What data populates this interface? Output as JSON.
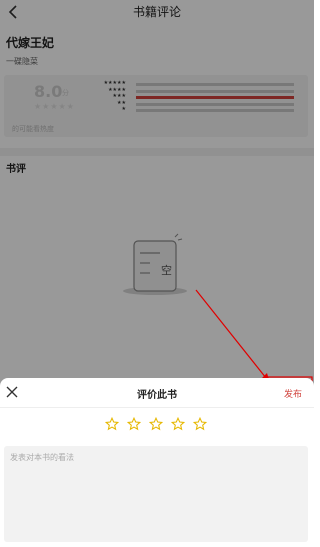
{
  "header": {
    "title": "书籍评论",
    "back_icon": "chevron-left-icon"
  },
  "book": {
    "name": "代嫁王妃",
    "author": "一碟隐菜"
  },
  "rating": {
    "score": "8.0",
    "score_unit": "分",
    "stars": "★★★★★",
    "note": "的可能看热度",
    "distribution": [
      {
        "stars": "★★★★★",
        "fraction": 0.0
      },
      {
        "stars": "★★★★",
        "fraction": 0.0
      },
      {
        "stars": "★★★",
        "fraction": 1.0
      },
      {
        "stars": "★★",
        "fraction": 0.0
      },
      {
        "stars": "★",
        "fraction": 0.0
      }
    ],
    "accent_color": "#d0423c"
  },
  "reviews": {
    "section_title": "书评",
    "empty_label": "空"
  },
  "sheet": {
    "close_icon": "close-icon",
    "title": "评价此书",
    "publish_label": "发布",
    "star_count": 5,
    "star_color": "#e6b800",
    "textarea_placeholder": "发表对本书的看法"
  }
}
